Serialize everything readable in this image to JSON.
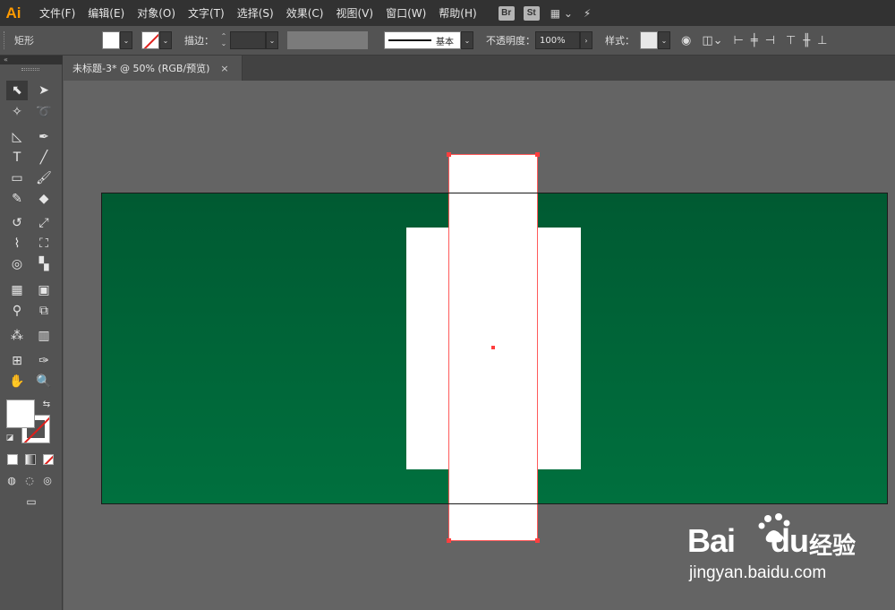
{
  "app": {
    "logo": "Ai"
  },
  "menu": {
    "items": [
      "文件(F)",
      "编辑(E)",
      "对象(O)",
      "文字(T)",
      "选择(S)",
      "效果(C)",
      "视图(V)",
      "窗口(W)",
      "帮助(H)"
    ],
    "badges": [
      "Br",
      "St"
    ]
  },
  "control": {
    "object_type": "矩形",
    "stroke_label": "描边：",
    "stroke_profile": "基本",
    "opacity_label": "不透明度：",
    "opacity_value": "100%",
    "style_label": "样式："
  },
  "document": {
    "tab_title": "未标题-3* @ 50% (RGB/预览)",
    "close_glyph": "×"
  },
  "colors": {
    "accent_logo": "#ff9a00",
    "artboard_top": "#005a32",
    "artboard_bottom": "#00703e",
    "selection": "#ff3e3e"
  },
  "watermark": {
    "brand": "Bai",
    "brand_suffix": "du",
    "cn": "经验",
    "url": "jingyan.baidu.com"
  }
}
